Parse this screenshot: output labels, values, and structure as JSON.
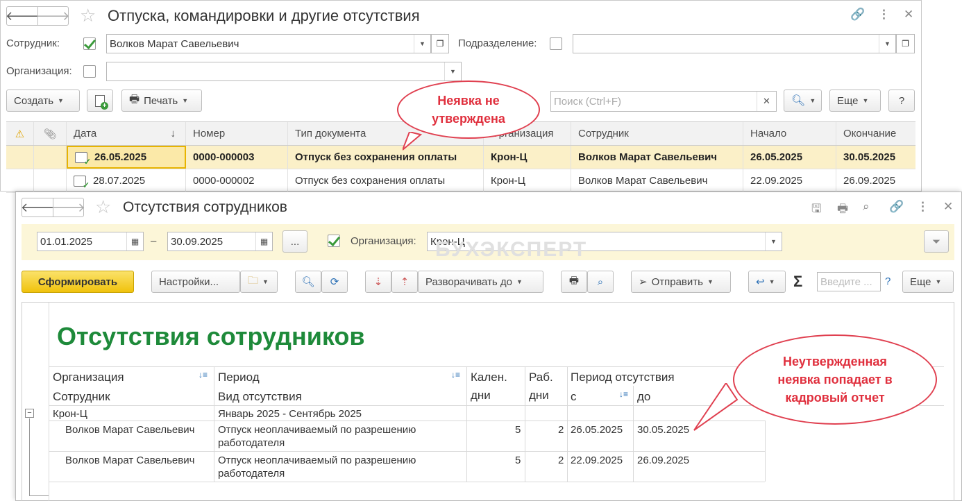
{
  "win1": {
    "title": "Отпуска, командировки и другие отсутствия",
    "filters": {
      "employee_label": "Сотрудник:",
      "employee_value": "Волков Марат Савельевич",
      "department_label": "Подразделение:",
      "department_value": "",
      "organization_label": "Организация:",
      "organization_value": ""
    },
    "toolbar": {
      "create": "Создать",
      "print": "Печать",
      "search_placeholder": "Поиск (Ctrl+F)",
      "more": "Еще",
      "help": "?"
    },
    "columns": [
      "Дата",
      "Номер",
      "Тип документа",
      "Организация",
      "Сотрудник",
      "Начало",
      "Окончание"
    ],
    "rows": [
      {
        "date": "26.05.2025",
        "number": "0000-000003",
        "type": "Отпуск без сохранения оплаты",
        "org": "Крон-Ц",
        "employee": "Волков Марат Савельевич",
        "start": "26.05.2025",
        "end": "30.05.2025"
      },
      {
        "date": "28.07.2025",
        "number": "0000-000002",
        "type": "Отпуск без сохранения оплаты",
        "org": "Крон-Ц",
        "employee": "Волков Марат Савельевич",
        "start": "22.09.2025",
        "end": "26.09.2025"
      }
    ]
  },
  "win2": {
    "title": "Отсутствия сотрудников",
    "date_from": "01.01.2025",
    "date_dash": "–",
    "date_to": "30.09.2025",
    "ellipsis": "...",
    "org_label": "Организация:",
    "org_value": "Крон-Ц",
    "watermark": "БУХЭКСПЕРТ",
    "toolbar": {
      "generate": "Сформировать",
      "settings": "Настройки...",
      "expand": "Разворачивать до",
      "send": "Отправить",
      "input_placeholder": "Введите ...",
      "help": "?",
      "more": "Еще"
    },
    "report": {
      "title": "Отсутствия сотрудников",
      "headers": {
        "org": "Организация",
        "employee": "Сотрудник",
        "period": "Период",
        "absence_type": "Вид отсутствия",
        "cal_1": "Кален.",
        "cal_2": "дни",
        "work_1": "Раб.",
        "work_2": "дни",
        "abs_period": "Период отсутствия",
        "from": "с",
        "to": "до"
      },
      "group": {
        "org": "Крон-Ц",
        "period": "Январь 2025 - Сентябрь 2025"
      },
      "rows": [
        {
          "employee": "Волков Марат Савельевич",
          "type_1": "Отпуск неоплачиваемый по разрешению",
          "type_2": "работодателя",
          "cal": "5",
          "work": "2",
          "from": "26.05.2025",
          "to": "30.05.2025"
        },
        {
          "employee": "Волков Марат Савельевич",
          "type_1": "Отпуск неоплачиваемый по разрешению",
          "type_2": "работодателя",
          "cal": "5",
          "work": "2",
          "from": "22.09.2025",
          "to": "26.09.2025"
        }
      ]
    }
  },
  "callouts": {
    "top_line1": "Неявка не",
    "top_line2": "утверждена",
    "right_line1": "Неутвержденная",
    "right_line2": "неявка попадает в",
    "right_line3": "кадровый отчет"
  },
  "colors": {
    "accent_green": "#1e8a3a",
    "callout_red": "#e0303e",
    "primary_button": "#f5cc1e",
    "selected_row": "#fbf0c8"
  }
}
